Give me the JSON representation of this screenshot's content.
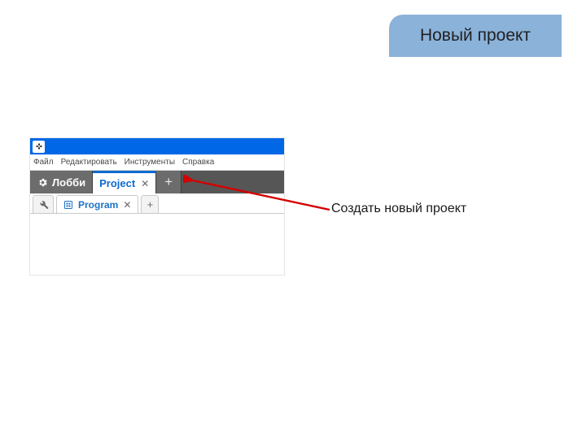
{
  "title": "Новый проект",
  "callout": "Создать новый проект",
  "screenshot": {
    "menus": {
      "file": "Файл",
      "edit": "Редактировать",
      "tools": "Инструменты",
      "help": "Справка"
    },
    "tabs": {
      "lobby": "Лобби",
      "project": "Project",
      "add_symbol": "+",
      "close_symbol": "✕"
    },
    "subtabs": {
      "program": "Program",
      "add_symbol": "+",
      "close_symbol": "✕"
    }
  }
}
